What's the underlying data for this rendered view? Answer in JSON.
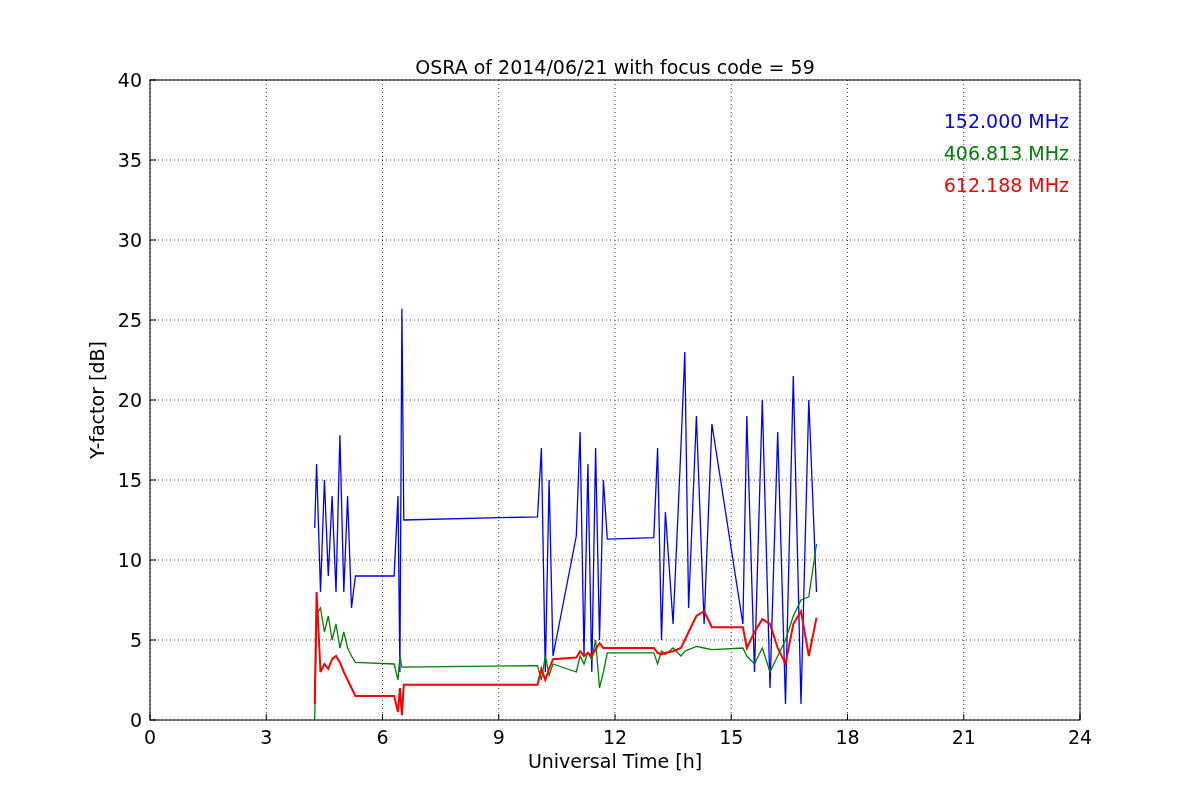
{
  "figure": {
    "chart_data": {
      "type": "line",
      "grid": true,
      "title": "OSRA of 2014/06/21 with focus code = 59",
      "xlabel": "Universal Time [h]",
      "ylabel": "Y-factor [dB]",
      "xlim": [
        0,
        24
      ],
      "ylim": [
        0,
        40
      ],
      "xticks": [
        0,
        3,
        6,
        9,
        12,
        15,
        18,
        21,
        24
      ],
      "yticks": [
        0,
        5,
        10,
        15,
        20,
        25,
        30,
        35,
        40
      ],
      "x": [
        4.25,
        4.3,
        4.4,
        4.5,
        4.6,
        4.7,
        4.8,
        4.9,
        5.0,
        5.1,
        5.2,
        5.3,
        6.3,
        6.4,
        6.45,
        6.5,
        6.55,
        10.0,
        10.1,
        10.2,
        10.3,
        10.4,
        11.0,
        11.1,
        11.2,
        11.3,
        11.4,
        11.5,
        11.6,
        11.7,
        11.8,
        13.0,
        13.1,
        13.2,
        13.3,
        13.5,
        13.7,
        13.8,
        13.9,
        14.1,
        14.3,
        14.5,
        15.3,
        15.4,
        15.6,
        15.8,
        16.0,
        16.2,
        16.4,
        16.6,
        16.8,
        17.0,
        17.2
      ],
      "series": [
        {
          "name": "152.000 MHz",
          "color": "#0000ff",
          "values": [
            12,
            16,
            8,
            15,
            9,
            14,
            8,
            17.8,
            8,
            14,
            7,
            9,
            9,
            14,
            3,
            25.7,
            12.5,
            12.7,
            17,
            3,
            15,
            4,
            11.5,
            18,
            4,
            16,
            3,
            17,
            5,
            15,
            11.3,
            11.4,
            17,
            5,
            13,
            6,
            17,
            23,
            7,
            19,
            6,
            18.5,
            6,
            19,
            3,
            20,
            2,
            18,
            1,
            21.5,
            1,
            20,
            8
          ]
        },
        {
          "name": "406.813 MHz",
          "color": "#008000",
          "values": [
            0,
            6.6,
            7,
            5.5,
            6.5,
            5,
            6,
            4.5,
            5.5,
            4.5,
            4,
            3.6,
            3.5,
            2.5,
            4,
            3.3,
            3.3,
            3.4,
            2.5,
            4,
            2.8,
            3.5,
            3,
            4,
            3.5,
            4.2,
            3.8,
            5,
            2,
            3,
            4.2,
            4.2,
            3.5,
            4.3,
            4.1,
            4.5,
            4,
            4.3,
            4.4,
            4.6,
            4.5,
            4.4,
            4.5,
            4,
            3.5,
            4.5,
            3,
            4,
            5,
            6.5,
            7.5,
            7.7,
            11
          ]
        },
        {
          "name": "612.188 MHz",
          "color": "#ff0000",
          "values": [
            1,
            8,
            3,
            3.5,
            3.2,
            3.8,
            4,
            3.6,
            3,
            2.5,
            2,
            1.5,
            1.5,
            0.5,
            2,
            0.3,
            2.2,
            2.2,
            3.2,
            2.5,
            3.2,
            3.8,
            3.9,
            4.3,
            4,
            4.2,
            4,
            4.4,
            4.8,
            4.5,
            4.5,
            4.5,
            4.2,
            4.1,
            4.2,
            4.3,
            4.5,
            5,
            5.5,
            6.5,
            6.8,
            5.8,
            5.8,
            4.5,
            5.5,
            6.3,
            6,
            4.5,
            3.5,
            6,
            6.8,
            4,
            6.4
          ]
        }
      ]
    }
  }
}
